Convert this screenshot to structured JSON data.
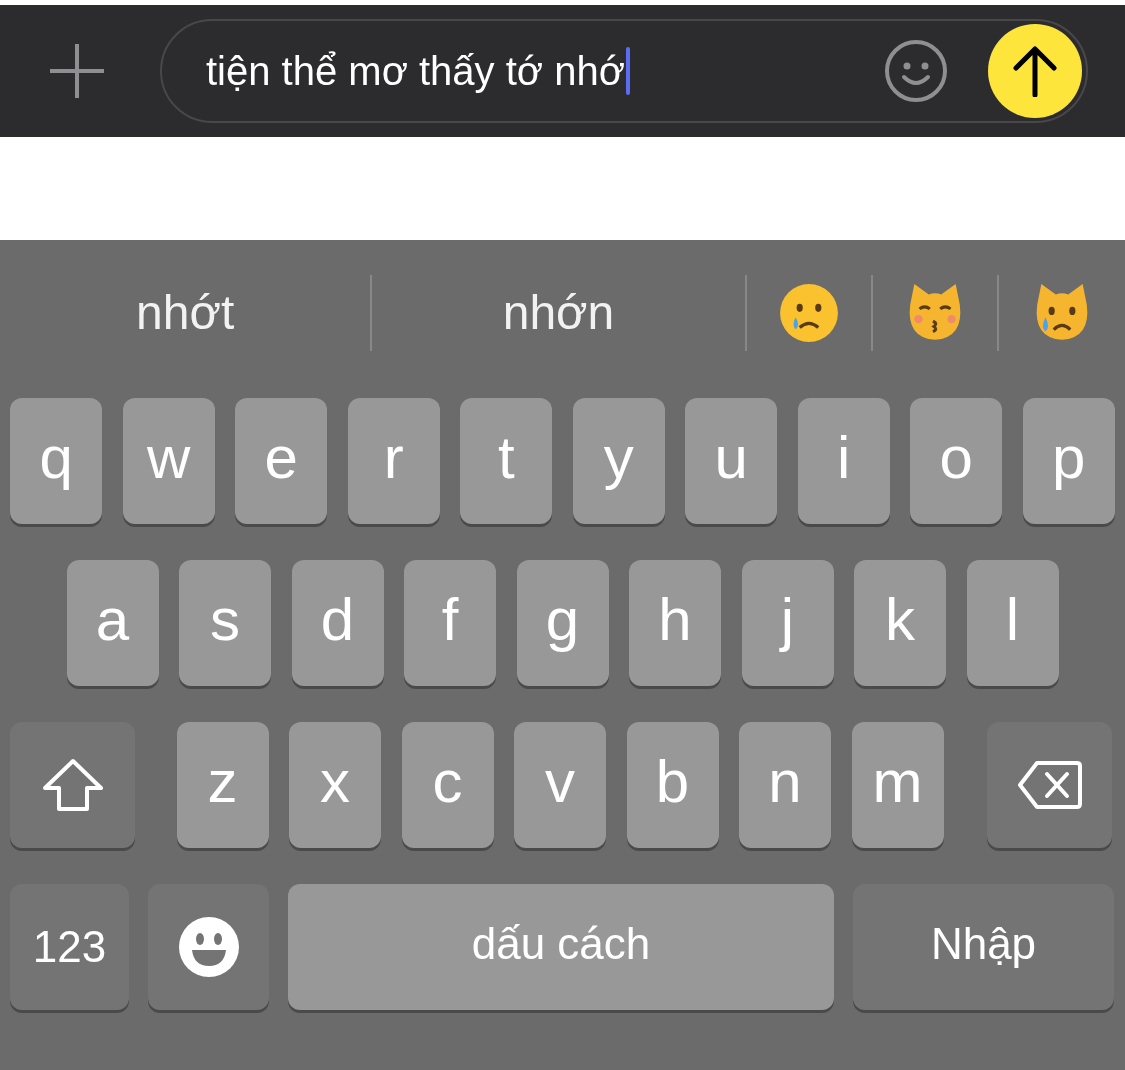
{
  "message_bar": {
    "message": "tiện thể mơ thấy tớ nhớ"
  },
  "suggestions": [
    {
      "kind": "word",
      "text": "nhớt"
    },
    {
      "kind": "word",
      "text": "nhớn"
    },
    {
      "kind": "crying-face"
    },
    {
      "kind": "kissing-cat"
    },
    {
      "kind": "crying-cat"
    }
  ],
  "keyboard": {
    "rows": [
      {
        "keys": [
          {
            "kind": "letter",
            "label": "q"
          },
          {
            "kind": "letter",
            "label": "w"
          },
          {
            "kind": "letter",
            "label": "e"
          },
          {
            "kind": "letter",
            "label": "r"
          },
          {
            "kind": "letter",
            "label": "t"
          },
          {
            "kind": "letter",
            "label": "y"
          },
          {
            "kind": "letter",
            "label": "u"
          },
          {
            "kind": "letter",
            "label": "i"
          },
          {
            "kind": "letter",
            "label": "o"
          },
          {
            "kind": "letter",
            "label": "p"
          }
        ]
      },
      {
        "keys": [
          {
            "kind": "letter",
            "label": "a"
          },
          {
            "kind": "letter",
            "label": "s"
          },
          {
            "kind": "letter",
            "label": "d"
          },
          {
            "kind": "letter",
            "label": "f"
          },
          {
            "kind": "letter",
            "label": "g"
          },
          {
            "kind": "letter",
            "label": "h"
          },
          {
            "kind": "letter",
            "label": "j"
          },
          {
            "kind": "letter",
            "label": "k"
          },
          {
            "kind": "letter",
            "label": "l"
          }
        ]
      },
      {
        "keys": [
          {
            "kind": "shift"
          },
          {
            "kind": "letter",
            "label": "z"
          },
          {
            "kind": "letter",
            "label": "x"
          },
          {
            "kind": "letter",
            "label": "c"
          },
          {
            "kind": "letter",
            "label": "v"
          },
          {
            "kind": "letter",
            "label": "b"
          },
          {
            "kind": "letter",
            "label": "n"
          },
          {
            "kind": "letter",
            "label": "m"
          },
          {
            "kind": "delete"
          }
        ]
      },
      {
        "keys": [
          {
            "kind": "numbers",
            "label": "123"
          },
          {
            "kind": "emoji"
          },
          {
            "kind": "space",
            "label": "dấu cách"
          },
          {
            "kind": "return",
            "label": "Nhập"
          }
        ]
      }
    ]
  }
}
